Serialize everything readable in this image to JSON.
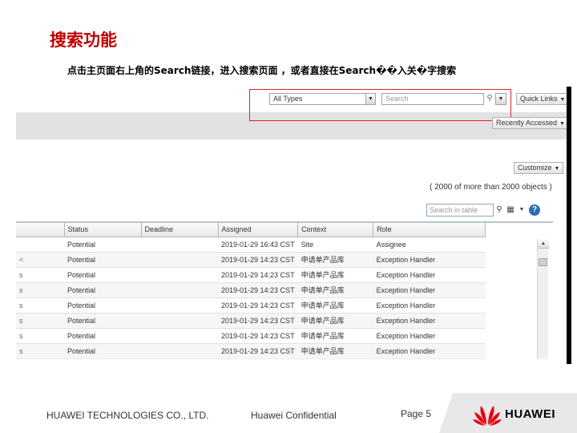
{
  "slide": {
    "title": "搜索功能",
    "subtitle": "点击主页面右上角的Search链接，进入搜索页面 ，或者直接在Search��入关�字搜索"
  },
  "toolbar": {
    "type_select": "All Types",
    "search_placeholder": "Search",
    "quick_links": "Quick Links",
    "recently_accessed": "Recently Accessed",
    "customize": "Customize"
  },
  "results": {
    "object_count": "( 2000 of more than 2000 objects )",
    "table_search_placeholder": "Search in table"
  },
  "table": {
    "columns": [
      "Status",
      "Deadline",
      "Assigned",
      "Context",
      "Role"
    ],
    "rows": [
      {
        "edge": "",
        "status": "Potential",
        "deadline": "",
        "assigned": "2019-01-29 16:43 CST",
        "context": "Site",
        "role": "Assignee"
      },
      {
        "edge": "<",
        "status": "Potential",
        "deadline": "",
        "assigned": "2019-01-29 14:23 CST",
        "context": "申请单产品库",
        "role": "Exception Handler"
      },
      {
        "edge": "s",
        "status": "Potential",
        "deadline": "",
        "assigned": "2019-01-29 14:23 CST",
        "context": "申请单产品库",
        "role": "Exception Handler"
      },
      {
        "edge": "s",
        "status": "Potential",
        "deadline": "",
        "assigned": "2019-01-29 14:23 CST",
        "context": "申请单产品库",
        "role": "Exception Handler"
      },
      {
        "edge": "s",
        "status": "Potential",
        "deadline": "",
        "assigned": "2019-01-29 14:23 CST",
        "context": "申请单产品库",
        "role": "Exception Handler"
      },
      {
        "edge": "s",
        "status": "Potential",
        "deadline": "",
        "assigned": "2019-01-29 14:23 CST",
        "context": "申请单产品库",
        "role": "Exception Handler"
      },
      {
        "edge": "s",
        "status": "Potential",
        "deadline": "",
        "assigned": "2019-01-29 14:23 CST",
        "context": "申请单产品库",
        "role": "Exception Handler"
      },
      {
        "edge": "s",
        "status": "Potential",
        "deadline": "",
        "assigned": "2019-01-29 14:23 CST",
        "context": "申请单产品库",
        "role": "Exception Handler"
      }
    ]
  },
  "footer": {
    "company": "HUAWEI TECHNOLOGIES CO., LTD.",
    "confidential": "Huawei Confidential",
    "page": "Page 5",
    "brand": "HUAWEI"
  },
  "colors": {
    "title": "#c00000",
    "highlight_frame": "#e8202a",
    "logo_red": "#e60012"
  }
}
